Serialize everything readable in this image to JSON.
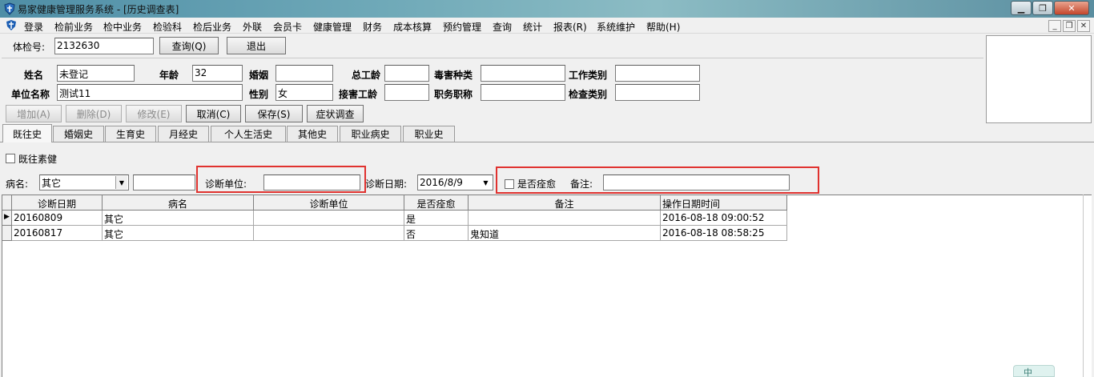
{
  "window": {
    "title": "易家健康管理服务系统 - [历史调查表]"
  },
  "menu": [
    "登录",
    "检前业务",
    "检中业务",
    "检验科",
    "检后业务",
    "外联",
    "会员卡",
    "健康管理",
    "财务",
    "成本核算",
    "预约管理",
    "查询",
    "统计",
    "报表(R)",
    "系统维护",
    "帮助(H)"
  ],
  "search": {
    "exam_no_label": "体检号:",
    "exam_no_value": "2132630",
    "query_button": "查询(Q)",
    "exit_button": "退出"
  },
  "patient": {
    "name_label": "姓名",
    "name_value": "未登记",
    "age_label": "年龄",
    "age_value": "32",
    "marriage_label": "婚姻",
    "marriage_value": "",
    "total_years_label": "总工龄",
    "total_years_value": "",
    "hazard_type_label": "毒害种类",
    "hazard_type_value": "",
    "work_type_label": "工作类别",
    "work_type_value": "",
    "company_label": "单位名称",
    "company_value": "测试11",
    "gender_label": "性别",
    "gender_value": "女",
    "exposure_years_label": "接害工龄",
    "exposure_years_value": "",
    "job_title_label": "职务职称",
    "job_title_value": "",
    "check_type_label": "检查类别",
    "check_type_value": ""
  },
  "actions": {
    "add": "增加(A)",
    "delete": "删除(D)",
    "edit": "修改(E)",
    "cancel": "取消(C)",
    "save": "保存(S)",
    "symptom": "症状调查"
  },
  "tabs": [
    "既往史",
    "婚姻史",
    "生育史",
    "月经史",
    "个人生活史",
    "其他史",
    "职业病史",
    "职业史"
  ],
  "history_form": {
    "healthy_label": "既往素健",
    "disease_label": "病名:",
    "disease_value": "其它",
    "disease_extra": "",
    "diag_unit_label": "诊断单位:",
    "diag_unit_value": "",
    "diag_date_label": "诊断日期:",
    "diag_date_value": "2016/8/9",
    "cured_label": "是否痊愈",
    "remark_label": "备注:",
    "remark_value": ""
  },
  "grid": {
    "columns": [
      "诊断日期",
      "病名",
      "诊断单位",
      "是否痊愈",
      "备注",
      "操作日期时间"
    ],
    "rows": [
      [
        "20160809",
        "其它",
        "",
        "是",
        "",
        "2016-08-18 09:00:52"
      ],
      [
        "20160817",
        "其它",
        "",
        "否",
        "鬼知道",
        "2016-08-18 08:58:25"
      ]
    ]
  },
  "ime": {
    "label": "中"
  },
  "colors": {
    "highlight_box": "#e0322f",
    "titlebar": "#6fa9b8"
  },
  "icons": [
    "app-shield-icon",
    "minimize-icon",
    "maximize-icon",
    "close-icon",
    "dropdown-arrow-icon",
    "row-pointer-icon"
  ]
}
